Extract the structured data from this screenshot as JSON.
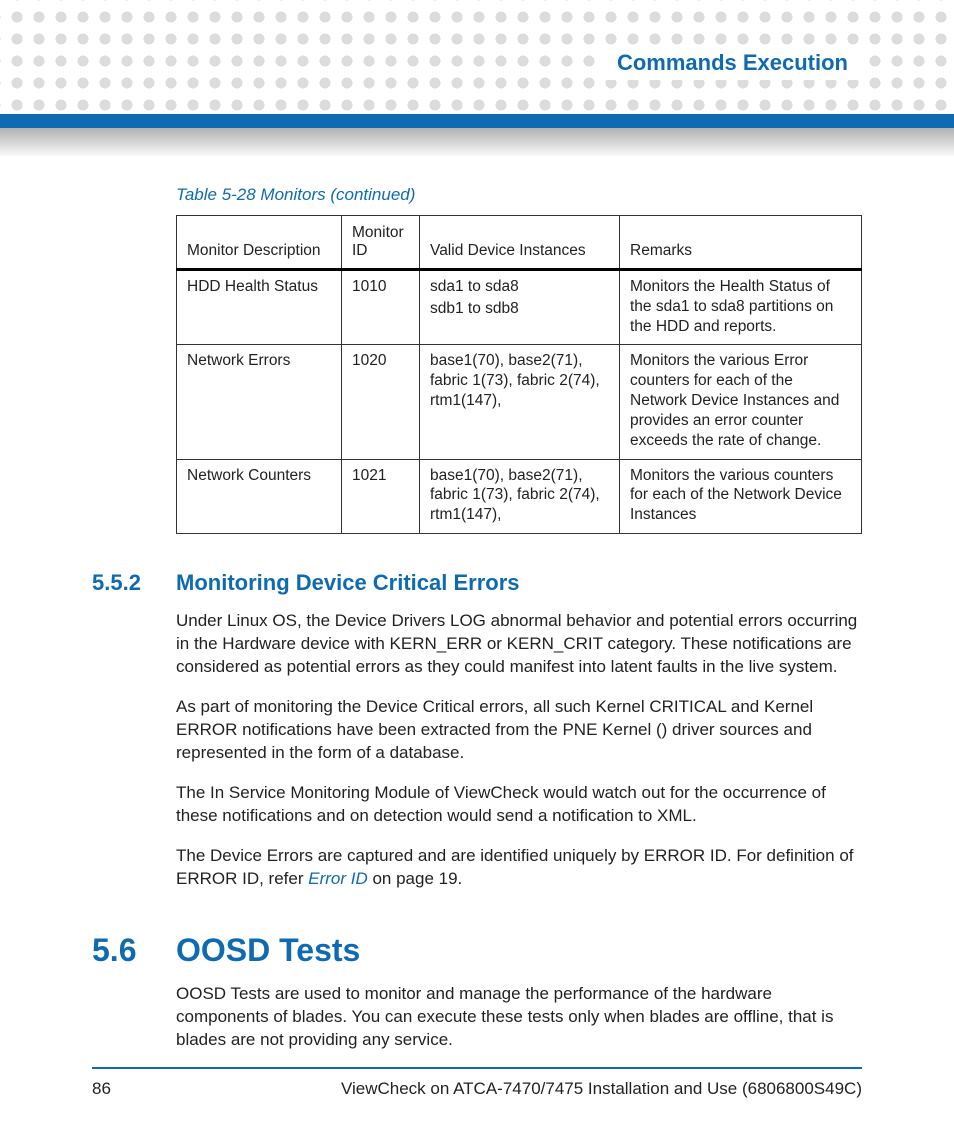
{
  "header": {
    "title": "Commands Execution"
  },
  "table": {
    "caption": "Table 5-28 Monitors (continued)",
    "headers": {
      "desc": "Monitor Description",
      "id": "Monitor ID",
      "inst": "Valid Device Instances",
      "rem": "Remarks"
    },
    "rows": [
      {
        "desc": "HDD Health Status",
        "id": "1010",
        "inst1": "sda1 to sda8",
        "inst2": "sdb1 to sdb8",
        "rem": "Monitors the Health Status of the sda1 to sda8 partitions on the HDD and reports."
      },
      {
        "desc": "Network Errors",
        "id": "1020",
        "inst1": "base1(70), base2(71), fabric 1(73), fabric 2(74), rtm1(147),",
        "inst2": "",
        "rem": "Monitors the various Error counters for each of the Network Device Instances and provides an error counter exceeds the rate of change."
      },
      {
        "desc": "Network Counters",
        "id": "1021",
        "inst1": "base1(70), base2(71), fabric 1(73), fabric 2(74), rtm1(147),",
        "inst2": "",
        "rem": "Monitors the various counters for each of the Network Device Instances"
      }
    ]
  },
  "section552": {
    "num": "5.5.2",
    "title": "Monitoring Device Critical Errors",
    "p1": "Under Linux OS, the Device Drivers LOG abnormal behavior and potential errors occurring in the Hardware device with KERN_ERR or KERN_CRIT category. These notifications are considered as potential errors as they could manifest into latent faults in the live system.",
    "p2": "As part of monitoring the Device Critical errors, all such Kernel CRITICAL and Kernel ERROR notifications have been extracted from the PNE Kernel () driver sources and represented in the form of a database.",
    "p3": "The In Service Monitoring Module of ViewCheck would watch out for the occurrence of these notifications and on detection would send a notification to XML.",
    "p4a": "The Device Errors are captured and are identified uniquely by ERROR ID. For definition of ERROR ID, refer ",
    "p4link": "Error ID",
    "p4b": " on page 19."
  },
  "section56": {
    "num": "5.6",
    "title": "OOSD Tests",
    "p1": "OOSD Tests are used to monitor and manage the performance of the hardware components of blades. You can execute these tests only when blades are offline, that is blades are not providing any service."
  },
  "footer": {
    "page": "86",
    "doc": "ViewCheck on ATCA-7470/7475 Installation and Use (6806800S49C)"
  }
}
